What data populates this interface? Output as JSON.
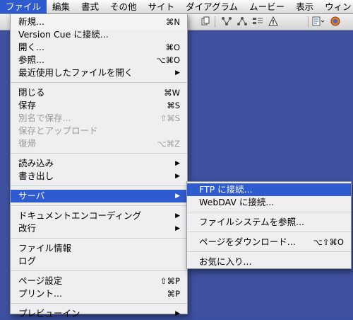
{
  "menubar": {
    "items": [
      "ファイル",
      "編集",
      "書式",
      "その他",
      "サイト",
      "ダイアグラム",
      "ムービー",
      "表示",
      "ウィン"
    ]
  },
  "toolbar": {
    "icons": [
      "new-page-icon",
      "site-icon",
      "diagram-icon",
      "table-icon",
      "warning-icon",
      "edit-list-icon",
      "browser-icon"
    ]
  },
  "file_menu": {
    "groups": [
      [
        {
          "label": "新規...",
          "shortcut": "⌘N",
          "enabled": true,
          "submenu": false
        },
        {
          "label": "Version Cue に接続...",
          "shortcut": "",
          "enabled": true,
          "submenu": false
        },
        {
          "label": "開く...",
          "shortcut": "⌘O",
          "enabled": true,
          "submenu": false
        },
        {
          "label": "参照...",
          "shortcut": "⌥⌘O",
          "enabled": true,
          "submenu": false
        },
        {
          "label": "最近使用したファイルを開く",
          "shortcut": "",
          "enabled": true,
          "submenu": true
        }
      ],
      [
        {
          "label": "閉じる",
          "shortcut": "⌘W",
          "enabled": true,
          "submenu": false
        },
        {
          "label": "保存",
          "shortcut": "⌘S",
          "enabled": true,
          "submenu": false
        },
        {
          "label": "別名で保存...",
          "shortcut": "⇧⌘S",
          "enabled": false,
          "submenu": false
        },
        {
          "label": "保存とアップロード",
          "shortcut": "",
          "enabled": false,
          "submenu": false
        },
        {
          "label": "復帰",
          "shortcut": "⌥⌘Z",
          "enabled": false,
          "submenu": false
        }
      ],
      [
        {
          "label": "読み込み",
          "shortcut": "",
          "enabled": true,
          "submenu": true
        },
        {
          "label": "書き出し",
          "shortcut": "",
          "enabled": true,
          "submenu": true
        }
      ],
      [
        {
          "label": "サーバ",
          "shortcut": "",
          "enabled": true,
          "submenu": true,
          "highlighted": true
        }
      ],
      [
        {
          "label": "ドキュメントエンコーディング",
          "shortcut": "",
          "enabled": true,
          "submenu": true
        },
        {
          "label": "改行",
          "shortcut": "",
          "enabled": true,
          "submenu": true
        }
      ],
      [
        {
          "label": "ファイル情報",
          "shortcut": "",
          "enabled": true,
          "submenu": false
        },
        {
          "label": "ログ",
          "shortcut": "",
          "enabled": true,
          "submenu": false
        }
      ],
      [
        {
          "label": "ページ設定",
          "shortcut": "⇧⌘P",
          "enabled": true,
          "submenu": false
        },
        {
          "label": "プリント...",
          "shortcut": "⌘P",
          "enabled": true,
          "submenu": false
        }
      ],
      [
        {
          "label": "プレビューイン",
          "shortcut": "",
          "enabled": true,
          "submenu": true
        }
      ]
    ]
  },
  "server_submenu": {
    "groups": [
      [
        {
          "label": "FTP に接続...",
          "shortcut": "",
          "highlighted": true
        },
        {
          "label": "WebDAV に接続...",
          "shortcut": ""
        }
      ],
      [
        {
          "label": "ファイルシステムを参照...",
          "shortcut": ""
        }
      ],
      [
        {
          "label": "ページをダウンロード...",
          "shortcut": "⌥⇧⌘O"
        }
      ],
      [
        {
          "label": "お気に入り...",
          "shortcut": ""
        }
      ]
    ]
  },
  "colors": {
    "highlight": "#2f5bd0",
    "desktop": "#3f519f"
  }
}
